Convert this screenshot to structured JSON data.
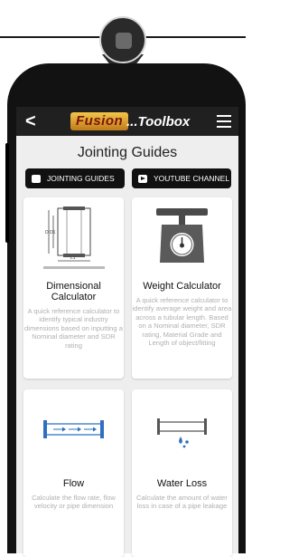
{
  "header": {
    "back_label": "<",
    "logo_text": "Fusion",
    "title": "...Toolbox"
  },
  "page": {
    "title": "Jointing Guides"
  },
  "buttons": {
    "jointing": "JOINTING GUIDES",
    "youtube": "YOUTUBE CHANNEL"
  },
  "cards": [
    {
      "title": "Dimensional Calculator",
      "desc": "A quick reference calculator to identify typical industry dimensions based on inputting a Nominal diameter and SDR rating"
    },
    {
      "title": "Weight Calculator",
      "desc": "A quick reference calculator to identify average weight and area across a tubular length. Based on a Nominal diameter, SDR rating, Material Grade and Length of object/fitting"
    },
    {
      "title": "Flow",
      "desc": "Calculate the flow rate, flow velocity or pipe dimension"
    },
    {
      "title": "Water Loss",
      "desc": "Calculate the amount of water loss in case of a pipe leakage"
    }
  ],
  "icons": {
    "back": "back-arrow-icon",
    "menu": "hamburger-menu-icon",
    "jointing": "document-icon",
    "youtube": "play-icon",
    "pin": "location-pin-icon"
  },
  "colors": {
    "app_bar": "#202020",
    "background": "#eeeeee",
    "button": "#111111",
    "logo_gold": "#e3a638",
    "logo_red": "#7b1508",
    "flow_blue": "#2f6fbf"
  }
}
